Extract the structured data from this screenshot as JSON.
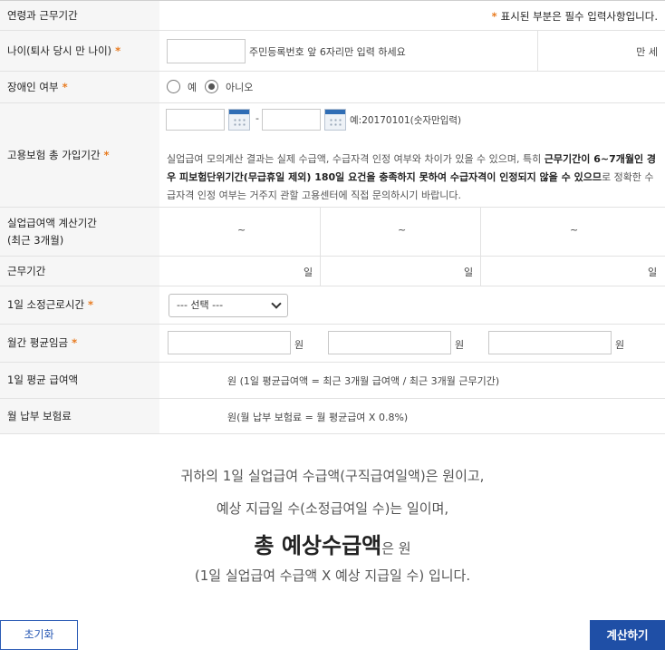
{
  "header": {
    "title": "연령과 근무기간",
    "required_star": "*",
    "required_note": "표시된 부분은 필수 입력사항입니다."
  },
  "age": {
    "label": "나이(퇴사 당시 만 나이)",
    "star": "*",
    "value": "",
    "hint": "주민등록번호 앞 6자리만 입력 하세요",
    "result": "만 세"
  },
  "disability": {
    "label": "장애인 여부",
    "star": "*",
    "options": [
      "예",
      "아니오"
    ],
    "selected": "아니오"
  },
  "insurance_period": {
    "label": "고용보험 총 가입기간",
    "star": "*",
    "start": "",
    "end": "",
    "dash": "-",
    "example": "예:20170101(숫자만입력)",
    "note_part1": "실업급여 모의계산 결과는 실제 수급액, 수급자격 인정 여부와 차이가 있을 수 있으며, 특히 ",
    "note_bold1": "근무기간이 6~7개월인 경우 피보험단위기간(무급휴일 제외) 180일 요건을 충족하지 못하여 수급자격이 인정되지 않을 수 있으므",
    "note_part2": "로 정확한 수급자격 인정 여부는 거주지 관할 고용센터에 직접 문의하시기 바랍니다."
  },
  "calc_period": {
    "label_line1": "실업급여액 계산기간",
    "label_line2": "(최근 3개월)",
    "columns": [
      "~",
      "~",
      "~"
    ]
  },
  "work_days": {
    "label": "근무기간",
    "unit": "일",
    "columns": [
      "일",
      "일",
      "일"
    ]
  },
  "daily_hours": {
    "label": "1일 소정근로시간",
    "star": "*",
    "selected": "--- 선택 ---"
  },
  "monthly_wage": {
    "label": "월간 평균임금",
    "star": "*",
    "unit": "원",
    "values": [
      "",
      "",
      ""
    ]
  },
  "daily_benefit": {
    "label": "1일 평균 급여액",
    "text": "원 (1일 평균급여액 = 최근 3개월 급여액 / 최근 3개월 근무기간)"
  },
  "monthly_premium": {
    "label": "월 납부 보험료",
    "text": "원(월 납부 보험료 = 월 평균급여 X 0.8%)"
  },
  "result": {
    "line1": "귀하의 1일 실업급여 수급액(구직급여일액)은 원이고,",
    "line2": "예상 지급일 수(소정급여일 수)는 일이며,",
    "line3_bold": "총 예상수급액",
    "line3_rest": "은 원",
    "line4": "(1일 실업급여 수급액 X 예상 지급일 수) 입니다."
  },
  "buttons": {
    "reset": "초기화",
    "calculate": "계산하기"
  },
  "colors": {
    "accent_star": "#e87a1e",
    "primary_blue": "#1f4fa6",
    "label_bg": "#f6f6f6"
  }
}
